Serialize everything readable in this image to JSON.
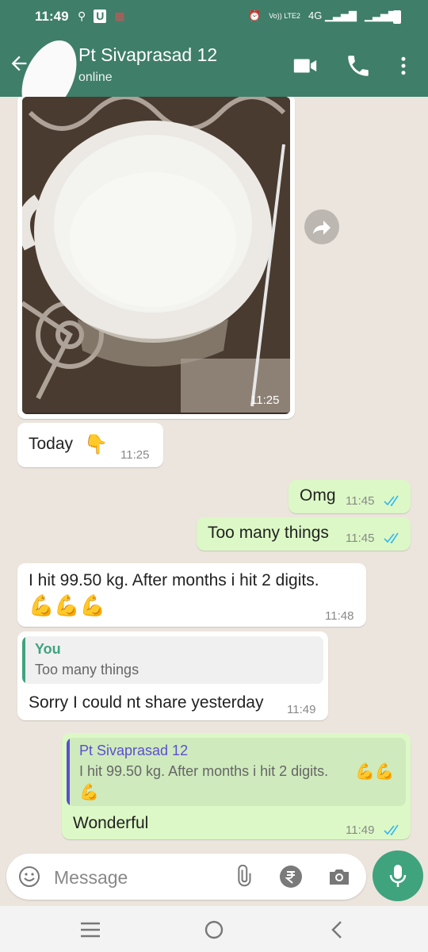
{
  "status_bar": {
    "time": "11:49",
    "left_icons": [
      "usb-icon",
      "u-badge-icon",
      "gallery-icon"
    ],
    "right_icons": [
      "alarm-icon",
      "volte-icon",
      "4g-signal-icon",
      "signal-icon",
      "battery-icon"
    ],
    "network_label": "4G",
    "volte_label": "Vo)) LTE2"
  },
  "header": {
    "contact_name": "Pt Sivaprasad 12",
    "contact_status": "online",
    "icons": [
      "back-arrow-icon",
      "video-call-icon",
      "phone-icon",
      "more-icon"
    ]
  },
  "messages": [
    {
      "type": "image",
      "direction": "in",
      "time": "11:25"
    },
    {
      "type": "text",
      "direction": "in",
      "text": "Today",
      "emoji": "👇",
      "time": "11:25"
    },
    {
      "type": "text",
      "direction": "out",
      "text": "Omg",
      "time": "11:45",
      "read": true
    },
    {
      "type": "text",
      "direction": "out",
      "text": "Too many things",
      "time": "11:45",
      "read": true
    },
    {
      "type": "text",
      "direction": "in",
      "text": "I hit 99.50 kg. After months i hit 2 digits.",
      "emoji": "💪💪💪",
      "time": "11:48"
    },
    {
      "type": "reply",
      "direction": "in",
      "quote_author": "You",
      "quote_text": "Too many things",
      "text": "Sorry I could nt share yesterday",
      "time": "11:49"
    },
    {
      "type": "reply",
      "direction": "out",
      "quote_author": "Pt Sivaprasad 12",
      "quote_text": "I hit 99.50 kg. After months i hit 2 digits.",
      "quote_emoji": "💪💪",
      "quote_emoji_line2": "💪",
      "text": "Wonderful",
      "time": "11:49",
      "read": true
    }
  ],
  "composer": {
    "placeholder": "Message",
    "icons": [
      "emoji-icon",
      "attach-icon",
      "rupee-icon",
      "camera-icon",
      "mic-icon"
    ]
  },
  "nav": {
    "icons": [
      "menu-icon",
      "home-icon",
      "back-icon"
    ]
  },
  "colors": {
    "header": "#3F7E69",
    "outgoing": "#DCF8C6",
    "incoming": "#ffffff",
    "tick": "#34B7F1",
    "quote_in_bar": "#3FA37E",
    "quote_out_bar": "#5B4FCF"
  }
}
